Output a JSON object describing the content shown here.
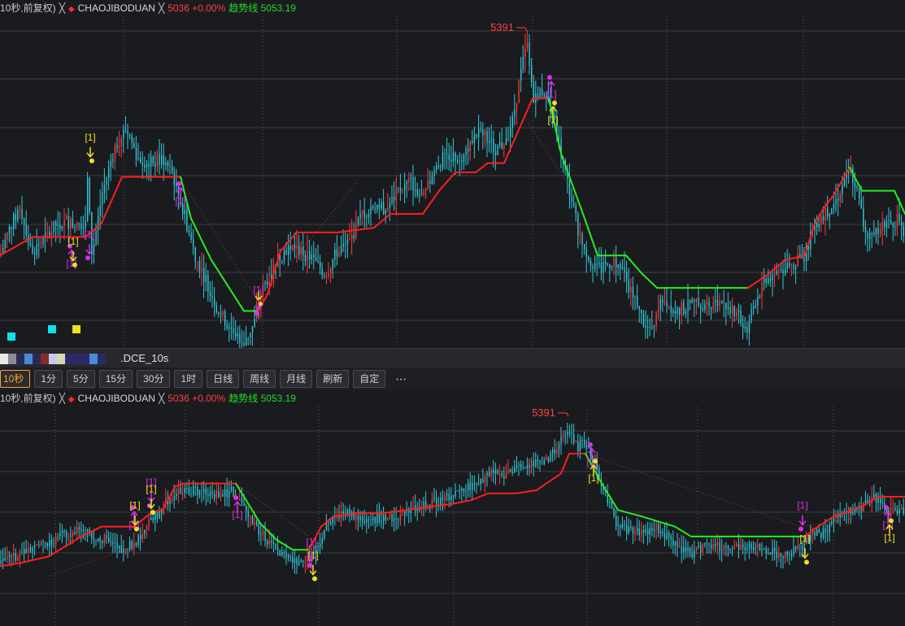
{
  "legend": {
    "period": "10秒,前复权)",
    "close_icon": "close-x-icon",
    "diamond_icon": "red-diamond-icon",
    "indicator_name": "CHAOJIBODUAN",
    "price_change": "5036 +0.00%",
    "trend_line_label": "趋势线 5053.19"
  },
  "peak_label": "5391",
  "signal_label": "[1]",
  "symbol_partial": ".DCE_10s",
  "toolbar": {
    "periods": [
      "10秒",
      "1分",
      "5分",
      "15分",
      "30分",
      "1时",
      "日线",
      "周线",
      "月线"
    ],
    "active_period": "10秒",
    "refresh": "刷新",
    "custom": "自定",
    "more": "⋯"
  },
  "colors": {
    "background": "#1a1b1f",
    "candle": "#32c8d8",
    "candle_up": "#ff3a3a",
    "trend_up": "#ff1e1e",
    "trend_down": "#22ee22",
    "signal_magenta": "#e02ee8",
    "signal_yellow": "#f0e020",
    "grid": "#3a3c42",
    "cyan_square": "#10e0ee"
  },
  "swatch_colors": [
    "#e8e8e8",
    "#8a8a9a",
    "#2a2a5a",
    "#4a8ad0",
    "#2a2a5a",
    "#8a2a2a",
    "#c8c8e8",
    "#d8d8b0",
    "#2a2a6a",
    "#2a2a6a",
    "#2a2a6a",
    "#4a8ad0",
    "#2a2a6a"
  ],
  "chart_top": {
    "type": "candlestick",
    "price_points": [
      [
        0,
        40
      ],
      [
        12,
        52
      ],
      [
        25,
        61
      ],
      [
        38,
        42
      ],
      [
        52,
        46
      ],
      [
        68,
        53
      ],
      [
        82,
        55
      ],
      [
        95,
        52
      ],
      [
        105,
        56
      ],
      [
        108,
        78
      ],
      [
        113,
        40
      ],
      [
        125,
        66
      ],
      [
        140,
        86
      ],
      [
        155,
        95
      ],
      [
        170,
        82
      ],
      [
        185,
        80
      ],
      [
        200,
        82
      ],
      [
        212,
        75
      ],
      [
        225,
        60
      ],
      [
        240,
        40
      ],
      [
        255,
        28
      ],
      [
        270,
        15
      ],
      [
        285,
        8
      ],
      [
        300,
        3
      ],
      [
        312,
        10
      ],
      [
        322,
        25
      ],
      [
        340,
        38
      ],
      [
        355,
        44
      ],
      [
        370,
        42
      ],
      [
        385,
        38
      ],
      [
        400,
        32
      ],
      [
        415,
        42
      ],
      [
        430,
        46
      ],
      [
        445,
        58
      ],
      [
        460,
        62
      ],
      [
        475,
        60
      ],
      [
        490,
        68
      ],
      [
        505,
        72
      ],
      [
        520,
        64
      ],
      [
        535,
        78
      ],
      [
        550,
        84
      ],
      [
        565,
        82
      ],
      [
        580,
        90
      ],
      [
        595,
        94
      ],
      [
        608,
        86
      ],
      [
        618,
        88
      ],
      [
        630,
        98
      ],
      [
        640,
        118
      ],
      [
        648,
        132
      ],
      [
        655,
        108
      ],
      [
        665,
        112
      ],
      [
        678,
        104
      ],
      [
        690,
        84
      ],
      [
        700,
        68
      ],
      [
        712,
        50
      ],
      [
        725,
        38
      ],
      [
        740,
        34
      ],
      [
        755,
        38
      ],
      [
        770,
        30
      ],
      [
        785,
        16
      ],
      [
        800,
        6
      ],
      [
        815,
        22
      ],
      [
        830,
        16
      ],
      [
        845,
        18
      ],
      [
        860,
        20
      ],
      [
        875,
        18
      ],
      [
        890,
        20
      ],
      [
        905,
        16
      ],
      [
        918,
        8
      ],
      [
        930,
        22
      ],
      [
        945,
        30
      ],
      [
        960,
        34
      ],
      [
        975,
        36
      ],
      [
        990,
        40
      ],
      [
        1000,
        52
      ],
      [
        1012,
        58
      ],
      [
        1025,
        62
      ],
      [
        1040,
        72
      ],
      [
        1045,
        78
      ],
      [
        1055,
        66
      ],
      [
        1065,
        48
      ],
      [
        1080,
        52
      ],
      [
        1095,
        54
      ],
      [
        1105,
        56
      ],
      [
        1113,
        50
      ]
    ],
    "trend_points": [
      [
        0,
        40
      ],
      [
        40,
        48
      ],
      [
        105,
        48
      ],
      [
        125,
        54
      ],
      [
        150,
        74
      ],
      [
        222,
        74
      ],
      [
        235,
        56
      ],
      [
        260,
        38
      ],
      [
        300,
        16
      ],
      [
        318,
        16
      ],
      [
        330,
        24
      ],
      [
        345,
        42
      ],
      [
        365,
        50
      ],
      [
        415,
        50
      ],
      [
        460,
        52
      ],
      [
        480,
        58
      ],
      [
        520,
        58
      ],
      [
        540,
        68
      ],
      [
        560,
        76
      ],
      [
        585,
        76
      ],
      [
        600,
        80
      ],
      [
        620,
        80
      ],
      [
        630,
        88
      ],
      [
        645,
        100
      ],
      [
        655,
        108
      ],
      [
        675,
        108
      ],
      [
        690,
        84
      ],
      [
        715,
        60
      ],
      [
        735,
        40
      ],
      [
        770,
        40
      ],
      [
        790,
        32
      ],
      [
        808,
        26
      ],
      [
        920,
        26
      ],
      [
        945,
        32
      ],
      [
        965,
        38
      ],
      [
        990,
        40
      ],
      [
        1000,
        52
      ],
      [
        1012,
        60
      ],
      [
        1025,
        66
      ],
      [
        1045,
        78
      ],
      [
        1060,
        68
      ],
      [
        1100,
        68
      ],
      [
        1113,
        58
      ]
    ],
    "dotted_guides": [
      [
        [
          220,
          74
        ],
        [
          318,
          20
        ]
      ],
      [
        [
          318,
          20
        ],
        [
          440,
          72
        ]
      ],
      [
        [
          645,
          100
        ],
        [
          700,
          70
        ]
      ]
    ],
    "signals": [
      {
        "x": 88,
        "y": 43,
        "color": "magenta",
        "dir": "down",
        "label": true
      },
      {
        "x": 90,
        "y": 37,
        "color": "yellow",
        "dir": "up",
        "label": true
      },
      {
        "x": 110,
        "y": 40,
        "color": "magenta",
        "dir": "up",
        "label": true
      },
      {
        "x": 111,
        "y": 82,
        "color": "yellow",
        "dir": "up",
        "label": true
      },
      {
        "x": 222,
        "y": 70,
        "color": "magenta",
        "dir": "down",
        "label": true
      },
      {
        "x": 318,
        "y": 20,
        "color": "yellow",
        "dir": "up",
        "label": false
      },
      {
        "x": 318,
        "y": 16,
        "color": "magenta",
        "dir": "up",
        "label": true
      },
      {
        "x": 678,
        "y": 116,
        "color": "magenta",
        "dir": "down",
        "label": true
      },
      {
        "x": 680,
        "y": 105,
        "color": "yellow",
        "dir": "down",
        "label": true
      }
    ],
    "ylim": [
      0,
      140
    ]
  },
  "chart_bottom": {
    "type": "candlestick",
    "price_points": [
      [
        0,
        38
      ],
      [
        20,
        42
      ],
      [
        40,
        46
      ],
      [
        60,
        50
      ],
      [
        80,
        56
      ],
      [
        100,
        60
      ],
      [
        115,
        54
      ],
      [
        130,
        52
      ],
      [
        150,
        46
      ],
      [
        165,
        50
      ],
      [
        180,
        60
      ],
      [
        195,
        68
      ],
      [
        205,
        76
      ],
      [
        215,
        80
      ],
      [
        225,
        82
      ],
      [
        240,
        82
      ],
      [
        255,
        80
      ],
      [
        270,
        78
      ],
      [
        285,
        82
      ],
      [
        298,
        72
      ],
      [
        310,
        62
      ],
      [
        325,
        54
      ],
      [
        340,
        46
      ],
      [
        355,
        40
      ],
      [
        370,
        38
      ],
      [
        385,
        42
      ],
      [
        395,
        54
      ],
      [
        410,
        66
      ],
      [
        425,
        68
      ],
      [
        440,
        66
      ],
      [
        455,
        64
      ],
      [
        470,
        66
      ],
      [
        485,
        64
      ],
      [
        500,
        70
      ],
      [
        515,
        72
      ],
      [
        530,
        74
      ],
      [
        545,
        76
      ],
      [
        560,
        80
      ],
      [
        575,
        84
      ],
      [
        590,
        88
      ],
      [
        605,
        92
      ],
      [
        620,
        92
      ],
      [
        635,
        94
      ],
      [
        650,
        98
      ],
      [
        665,
        98
      ],
      [
        680,
        104
      ],
      [
        690,
        112
      ],
      [
        700,
        118
      ],
      [
        710,
        108
      ],
      [
        720,
        112
      ],
      [
        730,
        100
      ],
      [
        740,
        86
      ],
      [
        750,
        72
      ],
      [
        760,
        60
      ],
      [
        775,
        58
      ],
      [
        790,
        56
      ],
      [
        805,
        60
      ],
      [
        820,
        54
      ],
      [
        835,
        46
      ],
      [
        850,
        44
      ],
      [
        865,
        48
      ],
      [
        880,
        48
      ],
      [
        895,
        46
      ],
      [
        910,
        48
      ],
      [
        925,
        48
      ],
      [
        940,
        46
      ],
      [
        955,
        44
      ],
      [
        970,
        44
      ],
      [
        985,
        48
      ],
      [
        1000,
        56
      ],
      [
        1015,
        56
      ],
      [
        1030,
        66
      ],
      [
        1045,
        70
      ],
      [
        1060,
        72
      ],
      [
        1075,
        78
      ],
      [
        1090,
        70
      ],
      [
        1100,
        68
      ],
      [
        1113,
        70
      ]
    ],
    "trend_points": [
      [
        0,
        36
      ],
      [
        25,
        38
      ],
      [
        60,
        42
      ],
      [
        100,
        54
      ],
      [
        125,
        60
      ],
      [
        165,
        60
      ],
      [
        185,
        68
      ],
      [
        200,
        70
      ],
      [
        215,
        84
      ],
      [
        225,
        86
      ],
      [
        290,
        86
      ],
      [
        305,
        74
      ],
      [
        320,
        62
      ],
      [
        340,
        52
      ],
      [
        360,
        46
      ],
      [
        380,
        46
      ],
      [
        395,
        60
      ],
      [
        410,
        66
      ],
      [
        440,
        68
      ],
      [
        470,
        68
      ],
      [
        500,
        70
      ],
      [
        530,
        72
      ],
      [
        560,
        74
      ],
      [
        580,
        76
      ],
      [
        600,
        80
      ],
      [
        635,
        80
      ],
      [
        660,
        82
      ],
      [
        690,
        92
      ],
      [
        700,
        104
      ],
      [
        720,
        104
      ],
      [
        740,
        86
      ],
      [
        760,
        70
      ],
      [
        790,
        66
      ],
      [
        830,
        60
      ],
      [
        850,
        54
      ],
      [
        990,
        54
      ],
      [
        1000,
        58
      ],
      [
        1025,
        66
      ],
      [
        1060,
        72
      ],
      [
        1080,
        78
      ],
      [
        1113,
        78
      ]
    ],
    "dotted_guides": [
      [
        [
          60,
          30
        ],
        [
          165,
          48
        ]
      ],
      [
        [
          290,
          86
        ],
        [
          380,
          54
        ]
      ],
      [
        [
          720,
          104
        ],
        [
          985,
          60
        ]
      ],
      [
        [
          985,
          60
        ],
        [
          1113,
          70
        ]
      ]
    ],
    "signals": [
      {
        "x": 165,
        "y": 70,
        "color": "magenta",
        "dir": "down",
        "label": true
      },
      {
        "x": 166,
        "y": 60,
        "color": "yellow",
        "dir": "up",
        "label": true
      },
      {
        "x": 186,
        "y": 74,
        "color": "magenta",
        "dir": "up",
        "label": true
      },
      {
        "x": 186,
        "y": 70,
        "color": "yellow",
        "dir": "up",
        "label": true
      },
      {
        "x": 292,
        "y": 76,
        "color": "magenta",
        "dir": "down",
        "label": true
      },
      {
        "x": 385,
        "y": 30,
        "color": "yellow",
        "dir": "up",
        "label": true
      },
      {
        "x": 383,
        "y": 38,
        "color": "magenta",
        "dir": "up",
        "label": true
      },
      {
        "x": 728,
        "y": 108,
        "color": "magenta",
        "dir": "down",
        "label": true
      },
      {
        "x": 730,
        "y": 98,
        "color": "yellow",
        "dir": "down",
        "label": true
      },
      {
        "x": 987,
        "y": 60,
        "color": "magenta",
        "dir": "up",
        "label": true
      },
      {
        "x": 990,
        "y": 40,
        "color": "yellow",
        "dir": "up",
        "label": true
      },
      {
        "x": 1092,
        "y": 70,
        "color": "magenta",
        "dir": "down",
        "label": true
      },
      {
        "x": 1094,
        "y": 62,
        "color": "yellow",
        "dir": "down",
        "label": true
      }
    ],
    "ylim": [
      0,
      130
    ]
  }
}
